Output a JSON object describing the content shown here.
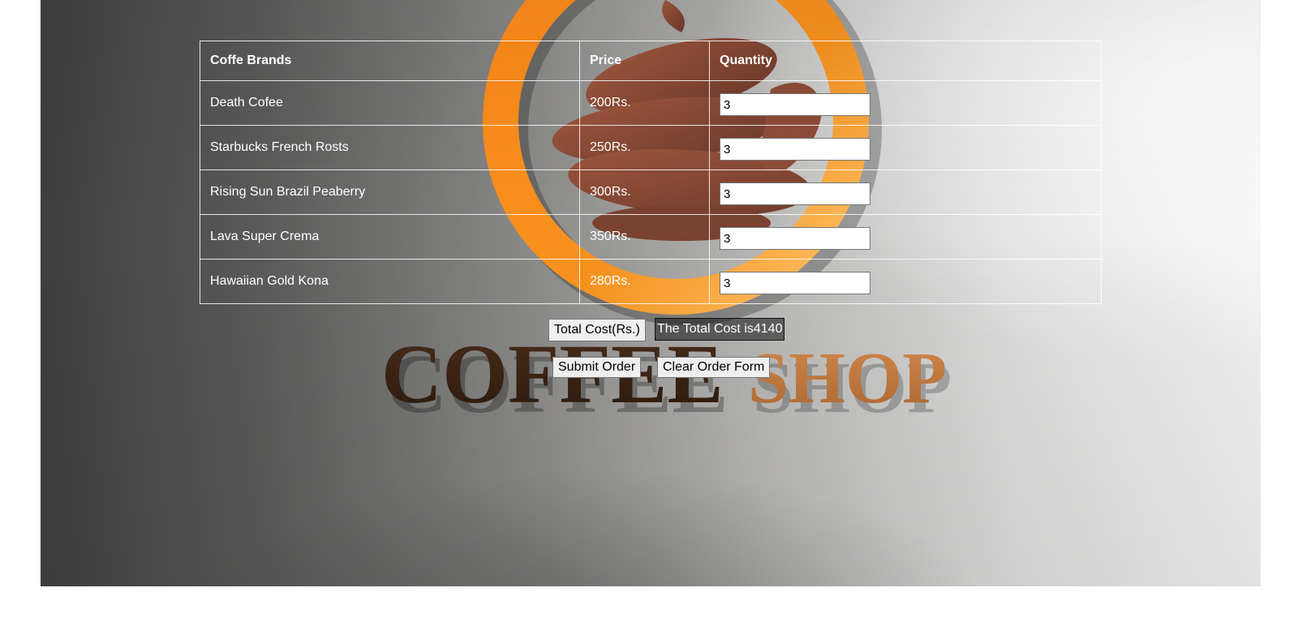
{
  "background": {
    "logo_text_left": "COFFEE",
    "logo_text_right": "SHOP",
    "colors": {
      "ring": "#f7921e",
      "beans": "#8a4a36",
      "text_dark": "#3b2414",
      "text_light": "#c9793c"
    }
  },
  "table": {
    "headers": [
      "Coffe Brands",
      "Price",
      "Quantity"
    ],
    "rows": [
      {
        "brand": "Death Cofee",
        "price": "200Rs.",
        "quantity": "3"
      },
      {
        "brand": "Starbucks French Rosts",
        "price": "250Rs.",
        "quantity": "3"
      },
      {
        "brand": "Rising Sun Brazil Peaberry",
        "price": "300Rs.",
        "quantity": "3"
      },
      {
        "brand": "Lava Super Crema",
        "price": "350Rs.",
        "quantity": "3"
      },
      {
        "brand": "Hawaiian Gold Kona",
        "price": "280Rs.",
        "quantity": "3"
      }
    ]
  },
  "actions": {
    "total_label": "Total Cost(Rs.)",
    "total_output": "The Total Cost is4140",
    "submit_label": "Submit Order",
    "clear_label": "Clear Order Form"
  }
}
